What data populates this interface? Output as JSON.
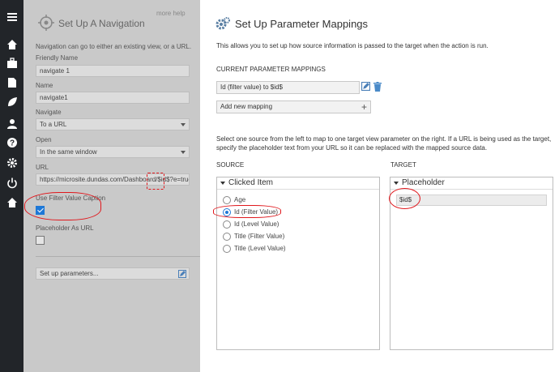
{
  "rail": {
    "icons": [
      "menu-icon",
      "home-icon",
      "briefcase-icon",
      "document-icon",
      "leaf-icon",
      "user-icon",
      "help-icon",
      "gear-icon",
      "power-icon",
      "home-icon"
    ]
  },
  "left": {
    "title": "Set Up A Navigation",
    "help": "more help",
    "description": "Navigation can go to either an existing view, or a URL.",
    "friendly_name_label": "Friendly Name",
    "friendly_name_value": "navigate 1",
    "name_label": "Name",
    "name_value": "navigate1",
    "navigate_label": "Navigate",
    "navigate_value": "To a URL",
    "open_label": "Open",
    "open_value": "In the same window",
    "url_label": "URL",
    "url_value": "https://microsite.dundas.com/Dashboard/$id$?e=true&",
    "use_filter_label": "Use Filter Value Caption",
    "use_filter_checked": true,
    "placeholder_label": "Placeholder As URL",
    "placeholder_checked": false,
    "setup_params": "Set up parameters..."
  },
  "right": {
    "title": "Set Up Parameter Mappings",
    "description": "This allows you to set up how source information is passed to the target when the action is run.",
    "current_label": "CURRENT PARAMETER MAPPINGS",
    "mapping": "Id (filter value) to $id$",
    "add_mapping": "Add new mapping",
    "instructions": "Select one source from the left to map to one target view parameter on the right. If a URL is being used as the target, specify the placeholder text from your URL so it can be replaced with the mapped source data.",
    "source_label": "SOURCE",
    "target_label": "TARGET",
    "source_header": "Clicked Item",
    "source_options": [
      "Age",
      "Id (Filter Value)",
      "Id (Level Value)",
      "Title (Filter Value)",
      "Title (Level Value)"
    ],
    "source_selected": 1,
    "target_header": "Placeholder",
    "target_value": "$id$"
  },
  "colors": {
    "rail": "#222529",
    "accent": "#1e78d7",
    "annotation": "#e0171c"
  }
}
